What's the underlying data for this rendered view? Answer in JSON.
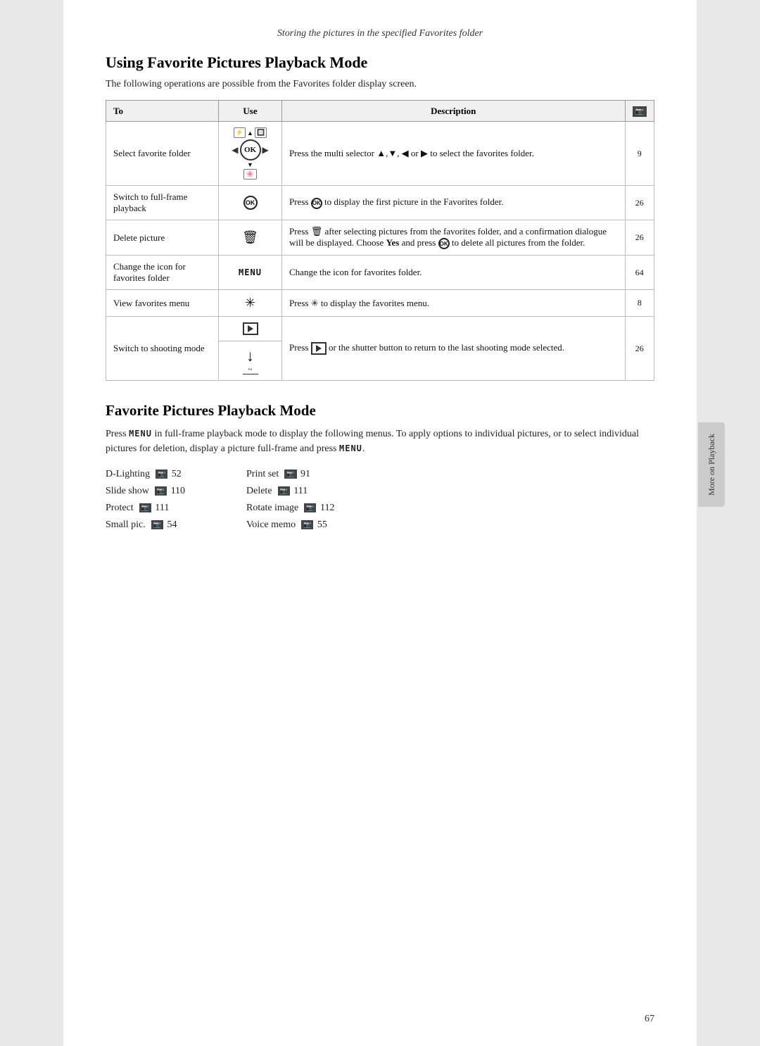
{
  "header": {
    "title": "Storing the pictures in the specified Favorites folder"
  },
  "section1": {
    "title": "Using Favorite Pictures Playback Mode",
    "intro": "The following operations are possible from the Favorites folder display screen.",
    "table": {
      "columns": [
        "To",
        "Use",
        "Description",
        "ref_icon"
      ],
      "rows": [
        {
          "to": "Select favorite folder",
          "use": "multi_selector_ok",
          "description": "Press the multi selector ▲,▼, ◀ or ▶ to select the favorites folder.",
          "ref": "9"
        },
        {
          "to": "Switch to full-frame playback",
          "use": "ok_circle",
          "description": "Press OK to display the first picture in the Favorites folder.",
          "ref": "26"
        },
        {
          "to": "Delete picture",
          "use": "trash",
          "description": "Press 🗑 after selecting pictures from the favorites folder, and a confirmation dialogue will be displayed. Choose Yes and press OK to delete all pictures from the folder.",
          "ref": "26"
        },
        {
          "to": "Change the icon for favorites folder",
          "use": "menu",
          "description": "Change the icon for favorites folder.",
          "ref": "64"
        },
        {
          "to": "View favorites menu",
          "use": "star",
          "description": "Press ✳ to display the favorites menu.",
          "ref": "8"
        },
        {
          "to": "Switch to shooting mode",
          "use": "play_and_down",
          "description": "Press ▶ or the shutter button to return to the last shooting mode selected.",
          "ref": "26"
        }
      ]
    }
  },
  "section2": {
    "title": "Favorite Pictures Playback Mode",
    "body_parts": [
      "Press MENU in full-frame playback mode to display the following menus. To apply options to individual pictures, or to select individual pictures for deletion, display a picture full-frame and press MENU.",
      ""
    ],
    "menu_items": [
      {
        "label": "D-Lighting",
        "ref": "52"
      },
      {
        "label": "Print set",
        "ref": "91"
      },
      {
        "label": "Slide show",
        "ref": "110"
      },
      {
        "label": "Delete",
        "ref": "111"
      },
      {
        "label": "Protect",
        "ref": "111"
      },
      {
        "label": "Rotate image",
        "ref": "112"
      },
      {
        "label": "Small pic.",
        "ref": "54"
      },
      {
        "label": "Voice memo",
        "ref": "55"
      }
    ]
  },
  "sidebar": {
    "label": "More on Playback"
  },
  "page_number": "67"
}
